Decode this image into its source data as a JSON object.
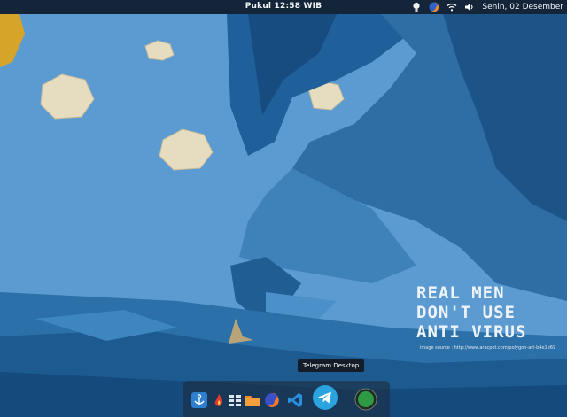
{
  "topbar": {
    "clock": "Pukul 12:58 WIB",
    "date": "Senin, 02 Desember",
    "tray_icons": [
      "bulb-icon",
      "firefox-tray-icon",
      "wifi-icon",
      "volume-icon"
    ]
  },
  "wallpaper": {
    "headline_lines": [
      "REAL MEN",
      "DON'T USE",
      "ANTI VIRUS"
    ],
    "image_source": "image source : http://www.aracpot.com/polygon-art-b4e1e69"
  },
  "dock": {
    "tooltip": "Telegram Desktop",
    "apps": [
      "anchor-app-icon",
      "flame-app-icon",
      "grid-app-icon",
      "files-app-icon",
      "firefox-app-icon",
      "vscode-app-icon",
      "telegram-app-icon",
      "green-app-icon"
    ]
  },
  "colors": {
    "topbar": "#0a1423",
    "sky": "#5b9ad0",
    "wave": "#2d6aa0",
    "telegram": "#2aa3de"
  }
}
